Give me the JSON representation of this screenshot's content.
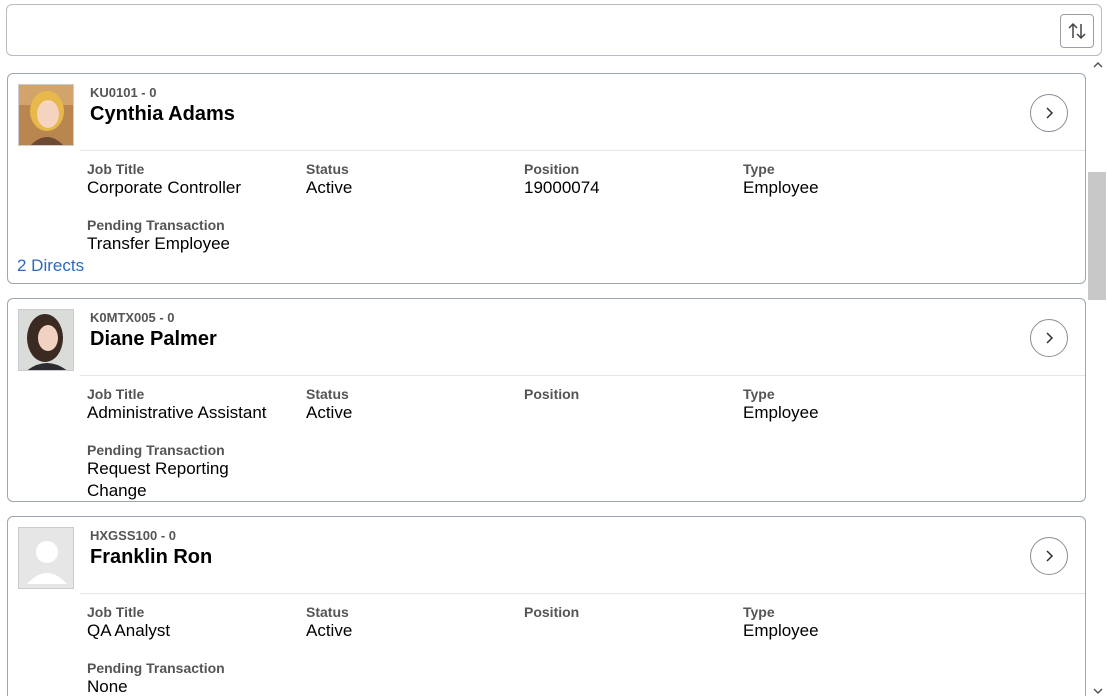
{
  "toolbar": {
    "sort_icon": "sort-arrows-icon"
  },
  "labels": {
    "job_title": "Job Title",
    "status": "Status",
    "position": "Position",
    "type": "Type",
    "pending": "Pending Transaction"
  },
  "people": [
    {
      "id": "KU0101 - 0",
      "name": "Cynthia Adams",
      "job_title": "Corporate Controller",
      "status": "Active",
      "position": "19000074",
      "type": "Employee",
      "pending": "Transfer Employee",
      "directs": "2 Directs",
      "avatar": "photo-woman-blonde"
    },
    {
      "id": "K0MTX005 - 0",
      "name": "Diane Palmer",
      "job_title": "Administrative Assistant",
      "status": "Active",
      "position": "",
      "type": "Employee",
      "pending": "Request Reporting Change",
      "directs": "",
      "avatar": "photo-woman-brunette"
    },
    {
      "id": "HXGSS100 - 0",
      "name": "Franklin Ron",
      "job_title": "QA Analyst",
      "status": "Active",
      "position": "",
      "type": "Employee",
      "pending": "None",
      "directs": "",
      "avatar": "placeholder-person-icon"
    }
  ],
  "colors": {
    "link": "#2a6bc4",
    "border": "#9ea6b0"
  }
}
